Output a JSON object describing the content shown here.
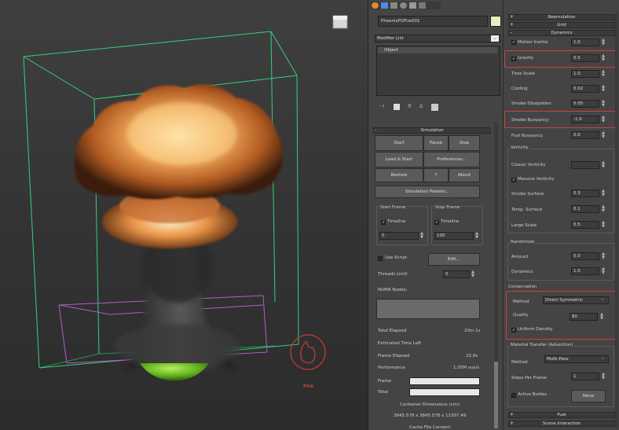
{
  "viewport": {
    "fire_label": "Fire"
  },
  "command_panel": {
    "object_name": "PhoenixFDFire001",
    "modifier_list": "Modifier List",
    "stack_item": "Object",
    "simulation": {
      "header": "Simulation",
      "start": "Start",
      "pause": "Pause",
      "stop": "Stop",
      "load_start": "Load & Start",
      "preferences": "Preferences...",
      "restore": "Restore",
      "help": "?",
      "about": "About",
      "presets": "Simulation Presets...",
      "start_frame_label": "Start Frame",
      "stop_frame_label": "Stop Frame",
      "timeline": "Timeline",
      "start_frame_value": "0",
      "stop_frame_value": "100",
      "use_script": "Use Script",
      "edit": "Edit...",
      "threads_limit": "Threads Limit",
      "threads_value": "0",
      "numa_nodes": "NUMA Nodes:",
      "total_elapsed_label": "Total Elapsed",
      "total_elapsed_value": "20m 1s",
      "est_time_label": "Estimated Time Left",
      "frame_elapsed_label": "Frame Elapsed",
      "frame_elapsed_value": "22.0s",
      "performance_label": "Performance",
      "performance_value": "1.05M vox/s",
      "frame_label": "Frame",
      "total_label": "Total",
      "container_dim_label": "Container Dimensions (cm):",
      "container_dim_value": "3845.578 x 3845.578 x 12397.49",
      "cache_file": "Cache File Content:"
    }
  },
  "rollout": {
    "reemulation": "Reemulation",
    "grid": "Grid",
    "dynamics": "Dynamics",
    "motion_inertia": "Motion Inertia",
    "motion_inertia_value": "1.0",
    "gravity": "Gravity",
    "gravity_value": "0.5",
    "time_scale": "Time Scale",
    "time_scale_value": "1.0",
    "cooling": "Cooling",
    "cooling_value": "0.02",
    "smoke_dissipation": "Smoke Dissipation",
    "smoke_dissipation_value": "0.05",
    "smoke_buoyancy": "Smoke Buoyancy",
    "smoke_buoyancy_value": "-1.0",
    "fuel_buoyancy": "Fuel Buoyancy",
    "fuel_buoyancy_value": "0.0",
    "vorticity": "Vorticity",
    "classic_vorticity": "Classic Vorticity",
    "classic_vorticity_value": "",
    "massive_vorticity": "Massive Vorticity",
    "smoke_surface": "Smoke Surface",
    "smoke_surface_value": "0.3",
    "temp_surface": "Temp. Surface",
    "temp_surface_value": "0.1",
    "large_scale": "Large Scale",
    "large_scale_value": "0.5",
    "randomize": "Randomize",
    "amount": "Amount",
    "amount_value": "0.0",
    "dynamics2": "Dynamics",
    "dynamics2_value": "1.0",
    "conservation": "Conservation",
    "method": "Method",
    "method_value": "Direct Symmetric",
    "quality": "Quality",
    "quality_value": "80",
    "uniform_density": "Uniform Density",
    "material_transfer": "Material Transfer (Advection)",
    "method2": "Method",
    "method2_value": "Multi-Pass",
    "steps_per_frame": "Steps Per Frame",
    "steps_per_frame_value": "1",
    "active_bodies": "Active Bodies",
    "none_button": "None",
    "fuel": "Fuel",
    "scene_interaction": "Scene Interaction"
  },
  "colors": {
    "highlight": "#d24040",
    "container_green": "#33d17a",
    "emitter_purple": "#b35cc9"
  }
}
